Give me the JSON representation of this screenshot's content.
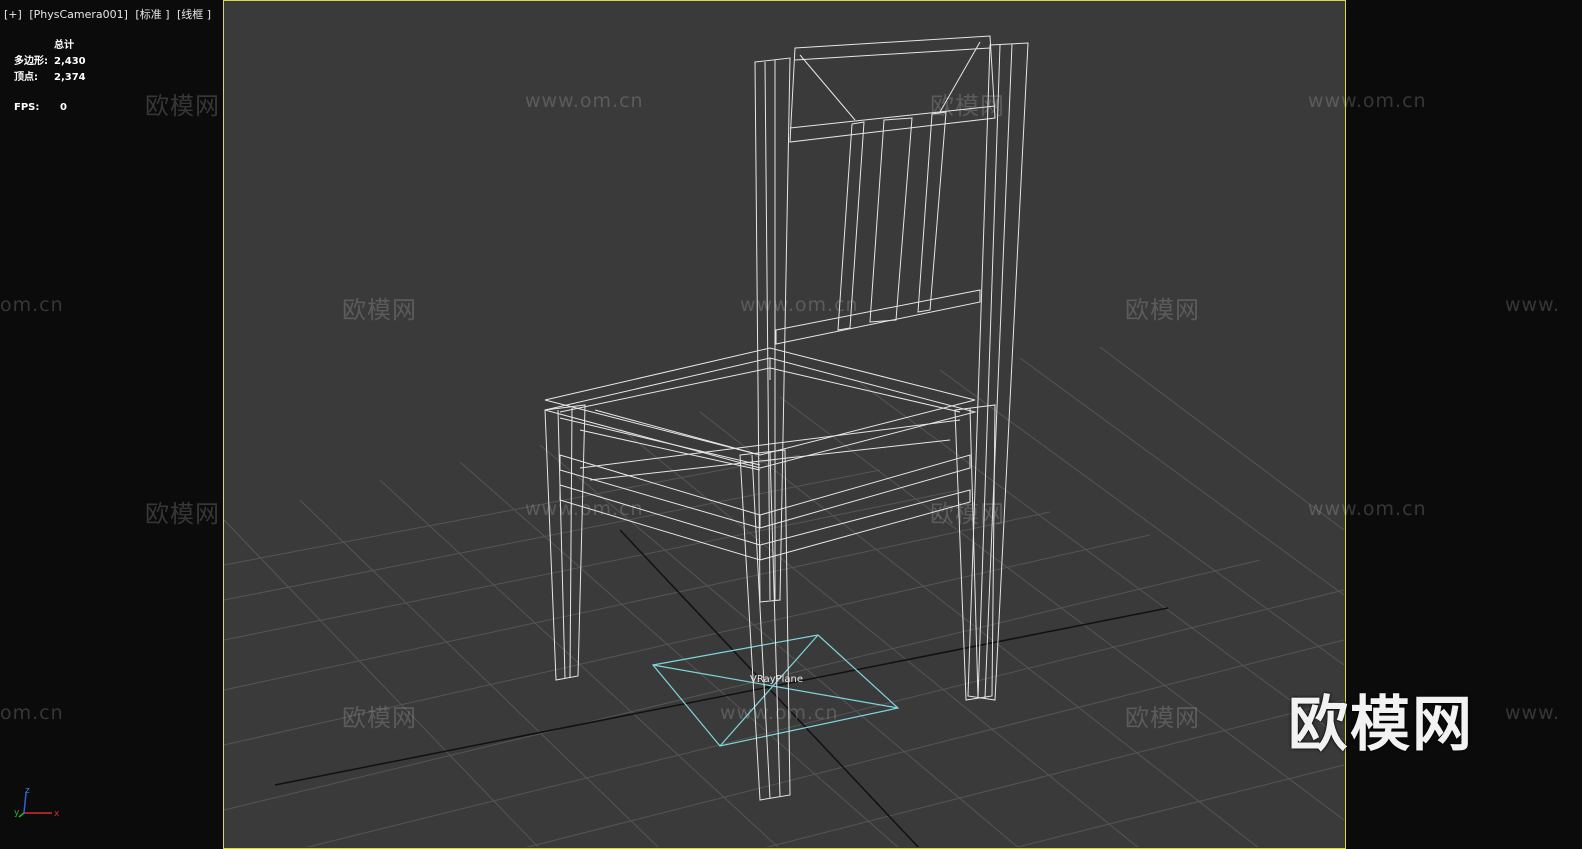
{
  "viewport": {
    "menu_plus": "[+]",
    "camera": "[PhysCamera001]",
    "shading": "[标准 ]",
    "display": "[线框 ]"
  },
  "stats": {
    "header": "总计",
    "polygons_label": "多边形:",
    "polygons_value": "2,430",
    "vertices_label": "顶点:",
    "vertices_value": "2,374",
    "fps_label": "FPS:",
    "fps_value": "0"
  },
  "scene": {
    "object_label": "VRayPlane",
    "grid_color": "#555555",
    "wire_color": "#e6e6e6",
    "plane_color": "#7fd6dc",
    "frame_color": "#d8d84a"
  },
  "watermarks": {
    "cn": "欧模网",
    "url": "www.om.cn",
    "url_partial_left": "om.cn",
    "url_partial_right": "www."
  },
  "brand_logo": "欧模网",
  "gizmo": {
    "x": "x",
    "y": "y",
    "z": "z"
  }
}
